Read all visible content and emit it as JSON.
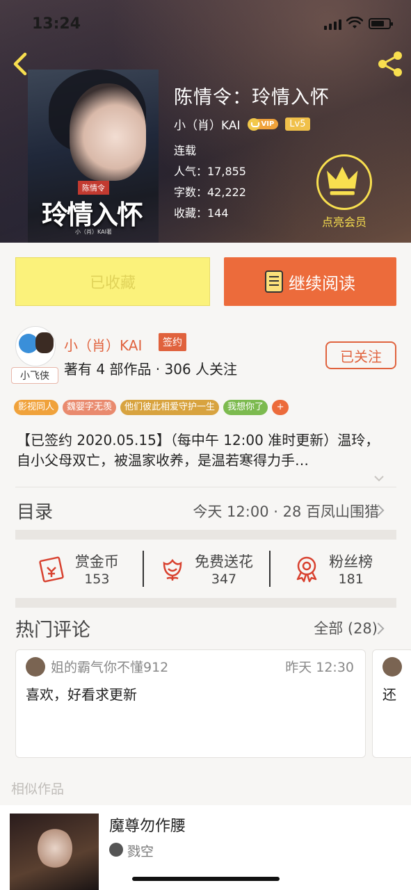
{
  "status_bar": {
    "time": "13:24"
  },
  "book": {
    "title": "陈情令：玲情入怀",
    "cover_seal": "陈情令",
    "cover_calligraphy": "玲情入怀",
    "cover_author": "小（肖）KAI著",
    "author": "小（肖）KAI",
    "vip_label": "VIP",
    "level": "Lv5",
    "state": "连载",
    "popularity": "人气：17,855",
    "word_count": "字数：42,222",
    "favorites": "收藏：144"
  },
  "member": {
    "label": "点亮会员"
  },
  "actions": {
    "collected_label": "已收藏",
    "continue_label": "继续阅读"
  },
  "author_info": {
    "name": "小（肖）KAI",
    "sign_badge": "签约",
    "stats": "著有 4 部作品 · 306 人关注",
    "follow_label": "已关注",
    "avatar_tag": "小飞侠"
  },
  "tags": [
    {
      "label": "影视同人",
      "color": "#f0a23b"
    },
    {
      "label": "魏婴字无羡",
      "color": "#e98a6e"
    },
    {
      "label": "他们彼此相爱守护一生",
      "color": "#d8a33f"
    },
    {
      "label": "我想你了",
      "color": "#7cba4f"
    },
    {
      "label": "+",
      "color": "#ec6b3b"
    }
  ],
  "description": "【已签约 2020.05.15】（每中午 12:00 准时更新）温玲，自小父母双亡，被温家收养，是温若寒得力手…",
  "catalog": {
    "title": "目录",
    "latest": "今天 12:00 · 28 百凤山围猎"
  },
  "rewards": [
    {
      "label": "赏金币",
      "value": "153",
      "icon": "red-envelope-icon"
    },
    {
      "label": "免费送花",
      "value": "347",
      "icon": "flower-icon"
    },
    {
      "label": "粉丝榜",
      "value": "181",
      "icon": "medal-icon"
    }
  ],
  "comments": {
    "title": "热门评论",
    "all_label": "全部 (28)",
    "items": [
      {
        "user": "姐的霸气你不懂912",
        "time": "昨天 12:30",
        "text": "喜欢，好看求更新"
      },
      {
        "user": "",
        "time": "",
        "text": "还"
      }
    ]
  },
  "similar": {
    "title": "相似作品",
    "items": [
      {
        "name": "魔尊勿作腰",
        "author": "戮空"
      }
    ]
  },
  "colors": {
    "accent": "#ec6b3b",
    "author_red": "#e0623d",
    "collected_yellow": "#fbf27b",
    "member_gold": "#f8df4f"
  }
}
